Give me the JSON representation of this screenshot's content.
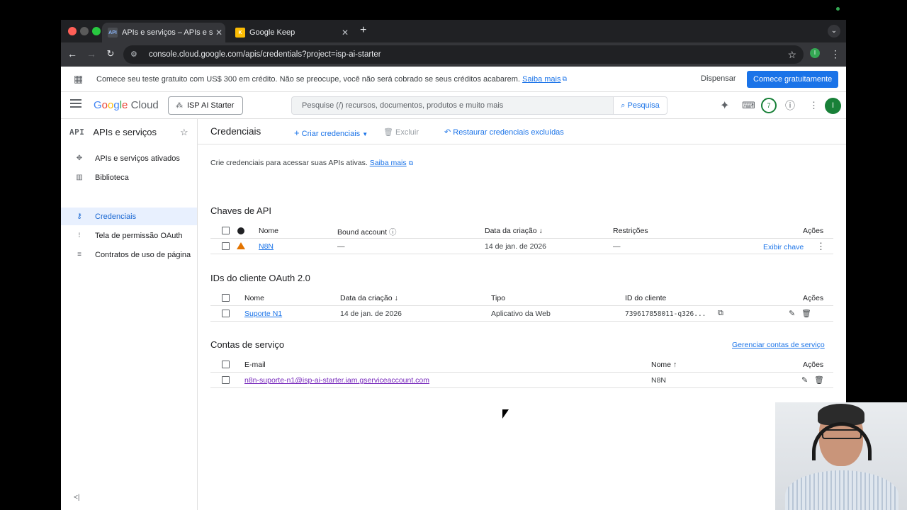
{
  "browser": {
    "tabs": [
      {
        "title": "APIs e serviços – APIs e serviços",
        "icon": "API"
      },
      {
        "title": "Google Keep",
        "icon": "K"
      }
    ],
    "url": "console.cloud.google.com/apis/credentials?project=isp-ai-starter",
    "profile_initial": "I"
  },
  "promo": {
    "text": "Comece seu teste gratuito com US$ 300 em crédito. Não se preocupe, você não será cobrado se seus créditos acabarem.",
    "link": "Saiba mais",
    "dismiss": "Dispensar",
    "cta": "Comece gratuitamente"
  },
  "header": {
    "logo_google": "Google",
    "logo_cloud": "Cloud",
    "project": "ISP AI Starter",
    "search_placeholder": "Pesquise (/) recursos, documentos, produtos e muito mais",
    "search_button": "Pesquisa",
    "notifications": "7",
    "avatar": "I"
  },
  "sidebar": {
    "badge": "API",
    "title": "APIs e serviços",
    "items": [
      {
        "label": "APIs e serviços ativados"
      },
      {
        "label": "Biblioteca"
      },
      {
        "label": "Credenciais"
      },
      {
        "label": "Tela de permissão OAuth"
      },
      {
        "label": "Contratos de uso de página"
      }
    ]
  },
  "main": {
    "title": "Credenciais",
    "create": "Criar credenciais",
    "delete": "Excluir",
    "restore": "Restaurar credenciais excluídas",
    "intro": "Crie credenciais para acessar suas APIs ativas.",
    "intro_link": "Saiba mais",
    "api_keys": {
      "title": "Chaves de API",
      "headers": {
        "name": "Nome",
        "bound": "Bound account",
        "created": "Data da criação",
        "restrictions": "Restrições",
        "actions": "Ações"
      },
      "rows": [
        {
          "name": "N8N",
          "bound": "—",
          "created": "14 de jan. de 2026",
          "restrictions": "—",
          "action": "Exibir chave"
        }
      ]
    },
    "oauth": {
      "title": "IDs do cliente OAuth 2.0",
      "headers": {
        "name": "Nome",
        "created": "Data da criação",
        "type": "Tipo",
        "client_id": "ID do cliente",
        "actions": "Ações"
      },
      "rows": [
        {
          "name": "Suporte N1",
          "created": "14 de jan. de 2026",
          "type": "Aplicativo da Web",
          "client_id": "739617858011-q326..."
        }
      ]
    },
    "service_accounts": {
      "title": "Contas de serviço",
      "manage": "Gerenciar contas de serviço",
      "headers": {
        "email": "E-mail",
        "name": "Nome",
        "actions": "Ações"
      },
      "rows": [
        {
          "email": "n8n-suporte-n1@isp-ai-starter.iam.gserviceaccount.com",
          "name": "N8N"
        }
      ]
    }
  }
}
